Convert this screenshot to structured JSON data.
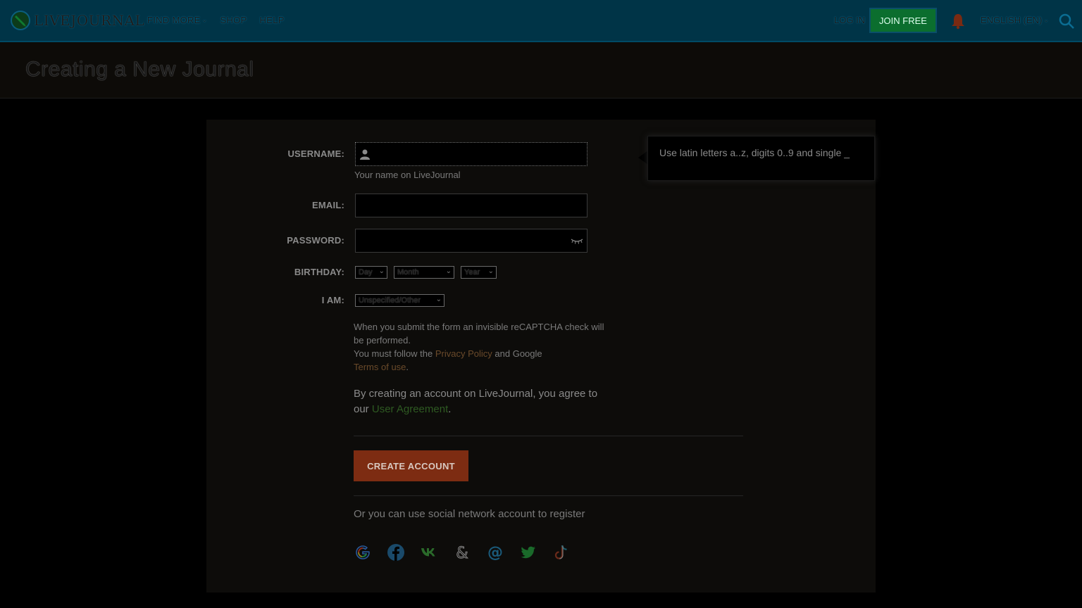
{
  "header": {
    "logo_text": "LIVEJOURNAL",
    "nav": [
      {
        "label": "FIND MORE",
        "has_dropdown": true
      },
      {
        "label": "SHOP",
        "has_dropdown": false
      },
      {
        "label": "HELP",
        "has_dropdown": false
      }
    ],
    "login_label": "LOG IN",
    "join_label": "JOIN FREE",
    "language_label": "ENGLISH (EN)",
    "icons": [
      "notification-bell-icon",
      "search-icon"
    ]
  },
  "page": {
    "title": "Creating a New Journal"
  },
  "form": {
    "username": {
      "label": "USERNAME:",
      "value": "",
      "hint": "Your name on LiveJournal"
    },
    "email": {
      "label": "EMAIL:",
      "value": ""
    },
    "password": {
      "label": "PASSWORD:",
      "value": ""
    },
    "birthday": {
      "label": "BIRTHDAY:",
      "day": "Day",
      "month": "Month",
      "year": "Year"
    },
    "gender": {
      "label": "I AM:",
      "value": "Unspecified/Other"
    },
    "tooltip": "Use latin letters a..z, digits 0..9 and single _",
    "recaptcha_line1": "When you submit the form an invisible reCAPTCHA check will be performed.",
    "recaptcha_line2_prefix": "You must follow the ",
    "privacy_link": "Privacy Policy",
    "recaptcha_line2_middle": " and Google ",
    "terms_link": "Terms of use",
    "recaptcha_line2_suffix": ".",
    "agree_prefix": "By creating an account on LiveJournal, you agree to our ",
    "agreement_link": "User Agreement",
    "agree_suffix": ".",
    "create_button": "CREATE ACCOUNT",
    "social_text": "Or you can use social network account to register",
    "social_networks": [
      "google-icon",
      "facebook-icon",
      "vk-icon",
      "ampersand-icon",
      "mail-ru-icon",
      "twitter-icon",
      "tiktok-icon"
    ]
  },
  "colors": {
    "topbar": "#003447",
    "join_button": "#0b6e2e",
    "create_button": "#7d2c12"
  }
}
